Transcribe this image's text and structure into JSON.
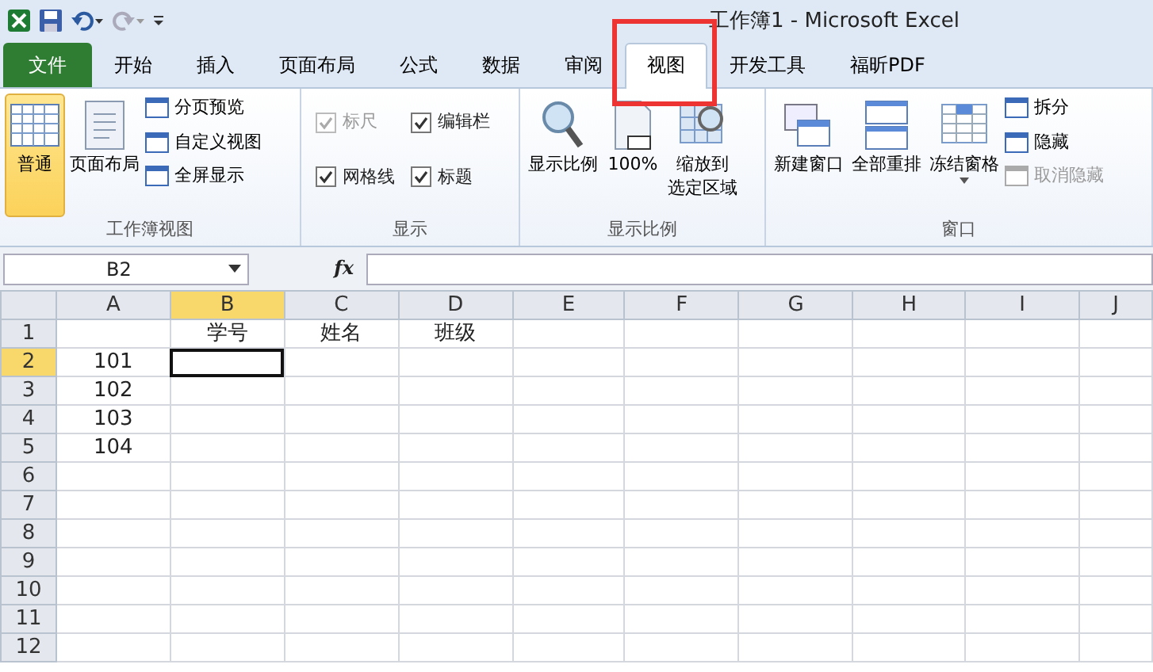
{
  "window": {
    "title": "工作簿1  -  Microsoft Excel"
  },
  "quick_access": {
    "redo_disabled": true
  },
  "tabs": [
    {
      "label": "文件",
      "kind": "file",
      "selected": false,
      "highlighted": false
    },
    {
      "label": "开始",
      "kind": "tab",
      "selected": false,
      "highlighted": false
    },
    {
      "label": "插入",
      "kind": "tab",
      "selected": false,
      "highlighted": false
    },
    {
      "label": "页面布局",
      "kind": "tab",
      "selected": false,
      "highlighted": false
    },
    {
      "label": "公式",
      "kind": "tab",
      "selected": false,
      "highlighted": false
    },
    {
      "label": "数据",
      "kind": "tab",
      "selected": false,
      "highlighted": false
    },
    {
      "label": "审阅",
      "kind": "tab",
      "selected": false,
      "highlighted": false
    },
    {
      "label": "视图",
      "kind": "tab",
      "selected": true,
      "highlighted": true
    },
    {
      "label": "开发工具",
      "kind": "tab",
      "selected": false,
      "highlighted": false
    },
    {
      "label": "福昕PDF",
      "kind": "tab",
      "selected": false,
      "highlighted": false
    }
  ],
  "ribbon_groups": [
    {
      "label": "工作簿视图",
      "items": [
        {
          "kind": "large",
          "lines": [
            "普通"
          ],
          "selected": true,
          "dropdown": false
        },
        {
          "kind": "large",
          "lines": [
            "页面布局"
          ],
          "selected": false,
          "dropdown": false
        },
        {
          "kind": "stack",
          "items": [
            {
              "label": "分页预览",
              "disabled": false
            },
            {
              "label": "自定义视图",
              "disabled": false
            },
            {
              "label": "全屏显示",
              "disabled": false
            }
          ]
        }
      ]
    },
    {
      "label": "显示",
      "items": [
        {
          "kind": "checks",
          "items": [
            {
              "label": "标尺",
              "checked": true,
              "disabled": true
            },
            {
              "label": "编辑栏",
              "checked": true,
              "disabled": false
            },
            {
              "label": "网格线",
              "checked": true,
              "disabled": false
            },
            {
              "label": "标题",
              "checked": true,
              "disabled": false
            }
          ]
        }
      ]
    },
    {
      "label": "显示比例",
      "items": [
        {
          "kind": "large",
          "lines": [
            "显示比例"
          ],
          "selected": false,
          "dropdown": false
        },
        {
          "kind": "large",
          "lines": [
            "100%"
          ],
          "selected": false,
          "dropdown": false
        },
        {
          "kind": "large",
          "lines": [
            "缩放到",
            "选定区域"
          ],
          "selected": false,
          "dropdown": false
        }
      ]
    },
    {
      "label": "窗口",
      "items": [
        {
          "kind": "large",
          "lines": [
            "新建窗口"
          ],
          "selected": false,
          "dropdown": false
        },
        {
          "kind": "large",
          "lines": [
            "全部重排"
          ],
          "selected": false,
          "dropdown": false
        },
        {
          "kind": "large",
          "lines": [
            "冻结窗格"
          ],
          "selected": false,
          "dropdown": true
        },
        {
          "kind": "stack",
          "items": [
            {
              "label": "拆分",
              "disabled": false
            },
            {
              "label": "隐藏",
              "disabled": false
            },
            {
              "label": "取消隐藏",
              "disabled": true
            }
          ]
        }
      ]
    }
  ],
  "formula_bar": {
    "name_box": "B2",
    "fx": "fx"
  },
  "sheet": {
    "columns": [
      {
        "label": "A",
        "selected": false
      },
      {
        "label": "B",
        "selected": true
      },
      {
        "label": "C",
        "selected": false
      },
      {
        "label": "D",
        "selected": false
      },
      {
        "label": "E",
        "selected": false
      },
      {
        "label": "F",
        "selected": false
      },
      {
        "label": "G",
        "selected": false
      },
      {
        "label": "H",
        "selected": false
      },
      {
        "label": "I",
        "selected": false
      },
      {
        "label": "J",
        "selected": false
      }
    ],
    "rows": [
      {
        "header": "1",
        "selected": false,
        "cells": [
          "",
          "学号",
          "姓名",
          "班级"
        ]
      },
      {
        "header": "2",
        "selected": true,
        "cells": [
          "101"
        ]
      },
      {
        "header": "3",
        "selected": false,
        "cells": [
          "102"
        ]
      },
      {
        "header": "4",
        "selected": false,
        "cells": [
          "103"
        ]
      },
      {
        "header": "5",
        "selected": false,
        "cells": [
          "104"
        ]
      },
      {
        "header": "6",
        "selected": false,
        "cells": []
      },
      {
        "header": "7",
        "selected": false,
        "cells": []
      },
      {
        "header": "8",
        "selected": false,
        "cells": []
      },
      {
        "header": "9",
        "selected": false,
        "cells": []
      },
      {
        "header": "10",
        "selected": false,
        "cells": []
      },
      {
        "header": "11",
        "selected": false,
        "cells": []
      },
      {
        "header": "12",
        "selected": false,
        "cells": []
      }
    ]
  }
}
